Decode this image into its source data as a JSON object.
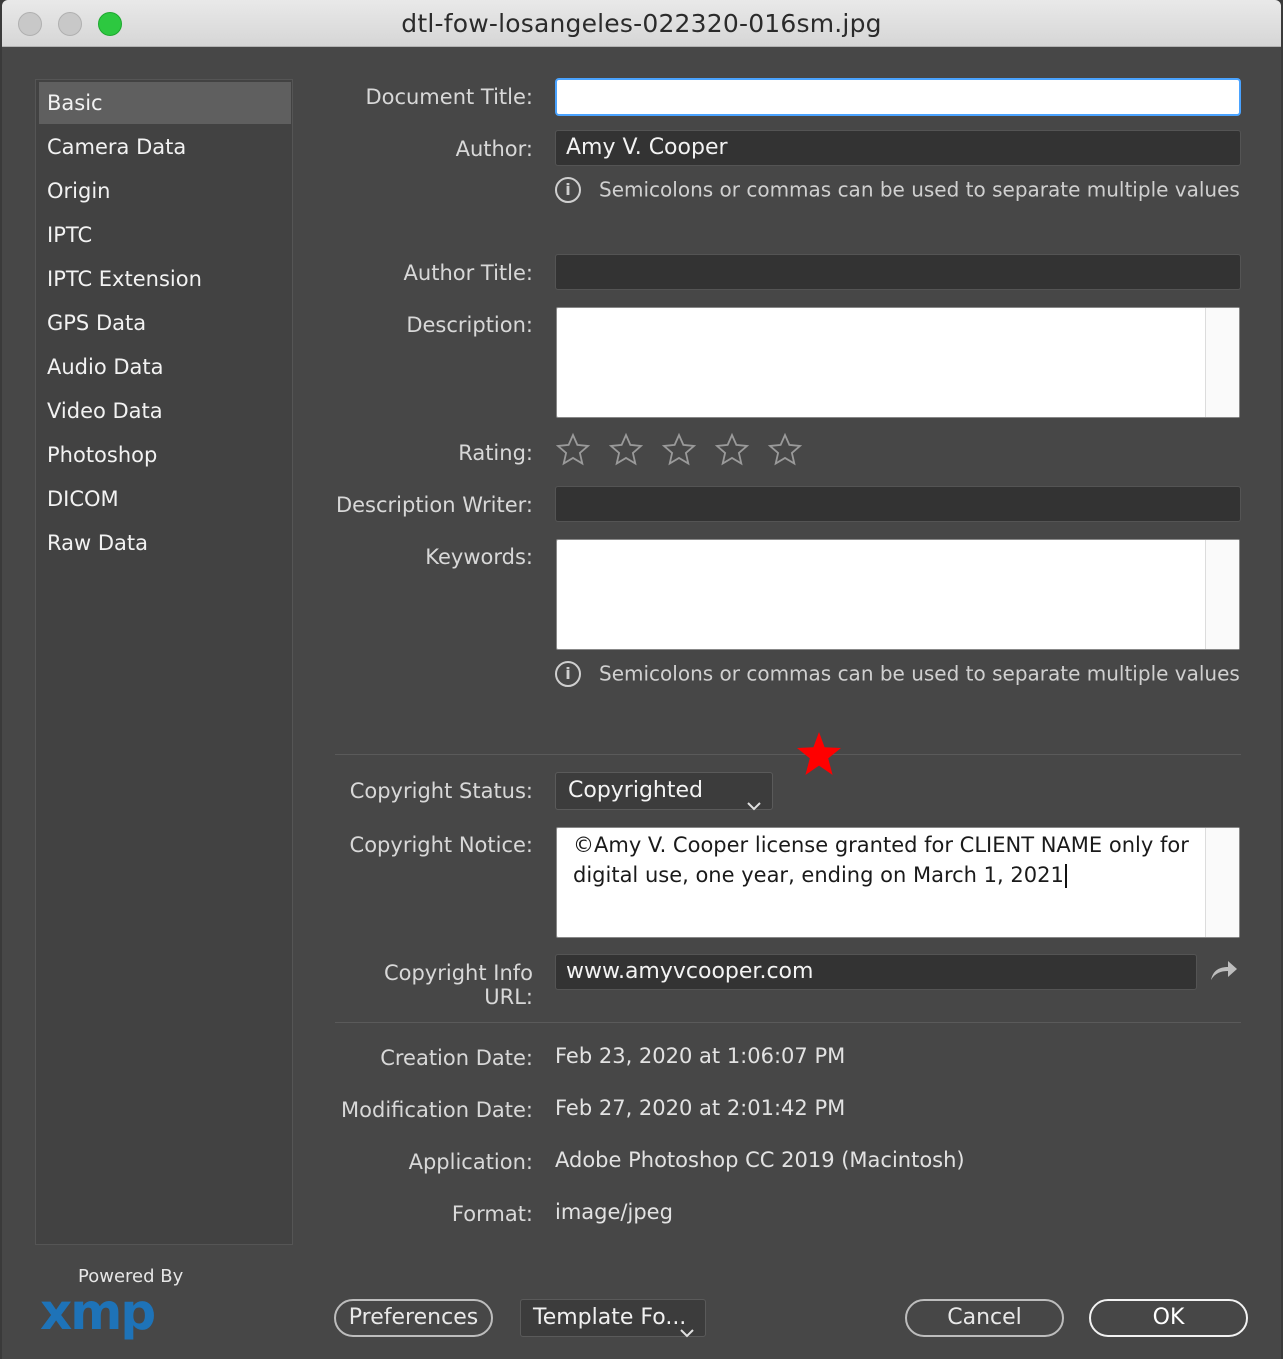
{
  "window": {
    "title": "dtl-fow-losangeles-022320-016sm.jpg"
  },
  "sidebar": {
    "items": [
      {
        "label": "Basic",
        "active": true
      },
      {
        "label": "Camera Data"
      },
      {
        "label": "Origin"
      },
      {
        "label": "IPTC"
      },
      {
        "label": "IPTC Extension"
      },
      {
        "label": "GPS Data"
      },
      {
        "label": "Audio Data"
      },
      {
        "label": "Video Data"
      },
      {
        "label": "Photoshop"
      },
      {
        "label": "DICOM"
      },
      {
        "label": "Raw Data"
      }
    ]
  },
  "form": {
    "document_title": {
      "label": "Document Title:",
      "value": ""
    },
    "author": {
      "label": "Author:",
      "value": "Amy V. Cooper"
    },
    "author_note": "Semicolons or commas can be used to separate multiple values",
    "author_title": {
      "label": "Author Title:",
      "value": ""
    },
    "description": {
      "label": "Description:",
      "value": ""
    },
    "rating": {
      "label": "Rating:",
      "value": 0,
      "max": 5
    },
    "description_writer": {
      "label": "Description Writer:",
      "value": ""
    },
    "keywords": {
      "label": "Keywords:",
      "value": ""
    },
    "keywords_note": "Semicolons or commas can be used to separate multiple values",
    "copyright_status": {
      "label": "Copyright Status:",
      "value": "Copyrighted"
    },
    "copyright_notice": {
      "label": "Copyright Notice:",
      "value": "©Amy V. Cooper license granted for CLIENT NAME only for digital use, one year, ending on March 1, 2021"
    },
    "copyright_url": {
      "label": "Copyright Info URL:",
      "value": "www.amyvcooper.com"
    }
  },
  "info": {
    "creation_date": {
      "label": "Creation Date:",
      "value": "Feb 23, 2020 at 1:06:07 PM"
    },
    "modification_date": {
      "label": "Modification Date:",
      "value": "Feb 27, 2020 at 2:01:42 PM"
    },
    "application": {
      "label": "Application:",
      "value": "Adobe Photoshop CC 2019 (Macintosh)"
    },
    "format": {
      "label": "Format:",
      "value": "image/jpeg"
    }
  },
  "footer": {
    "powered_by": "Powered By",
    "logo": "xmp",
    "preferences_label": "Preferences",
    "template_label": "Template Fo...",
    "cancel_label": "Cancel",
    "ok_label": "OK"
  },
  "icons": {
    "info": "info-circle-icon",
    "star_empty": "star-outline-icon",
    "marker_star": "red-star-icon",
    "share": "share-arrow-icon",
    "chevron": "chevron-down-icon"
  },
  "colors": {
    "background": "#474747",
    "focus_border": "#4aa3ff",
    "marker_star": "#ff0000",
    "logo": "#1e73b8"
  }
}
